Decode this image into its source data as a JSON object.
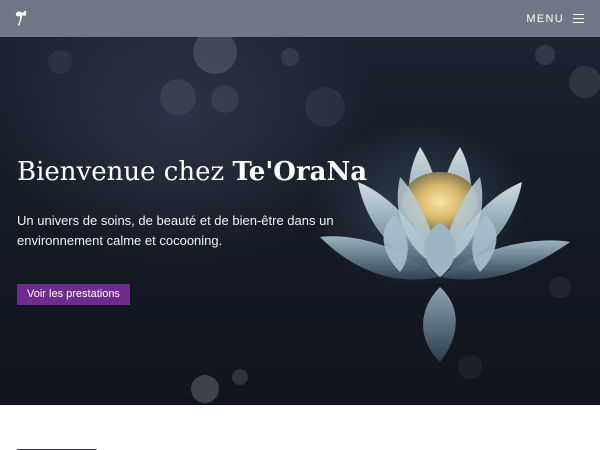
{
  "header": {
    "logo_icon": "lotus-logo-icon",
    "menu_label": "MENU",
    "menu_icon": "hamburger-icon"
  },
  "hero": {
    "title_prefix": "Bienvenue chez ",
    "title_brand": "Te'OraNa",
    "subtitle": "Un univers de soins, de beauté et de bien-être dans un environnement calme et cocooning.",
    "cta_label": "Voir les prestations",
    "background_image": "lotus-flower-image"
  },
  "colors": {
    "header_bg": "#6f7884",
    "cta_bg": "#6d2c8e",
    "hero_bg": "#161c26"
  }
}
